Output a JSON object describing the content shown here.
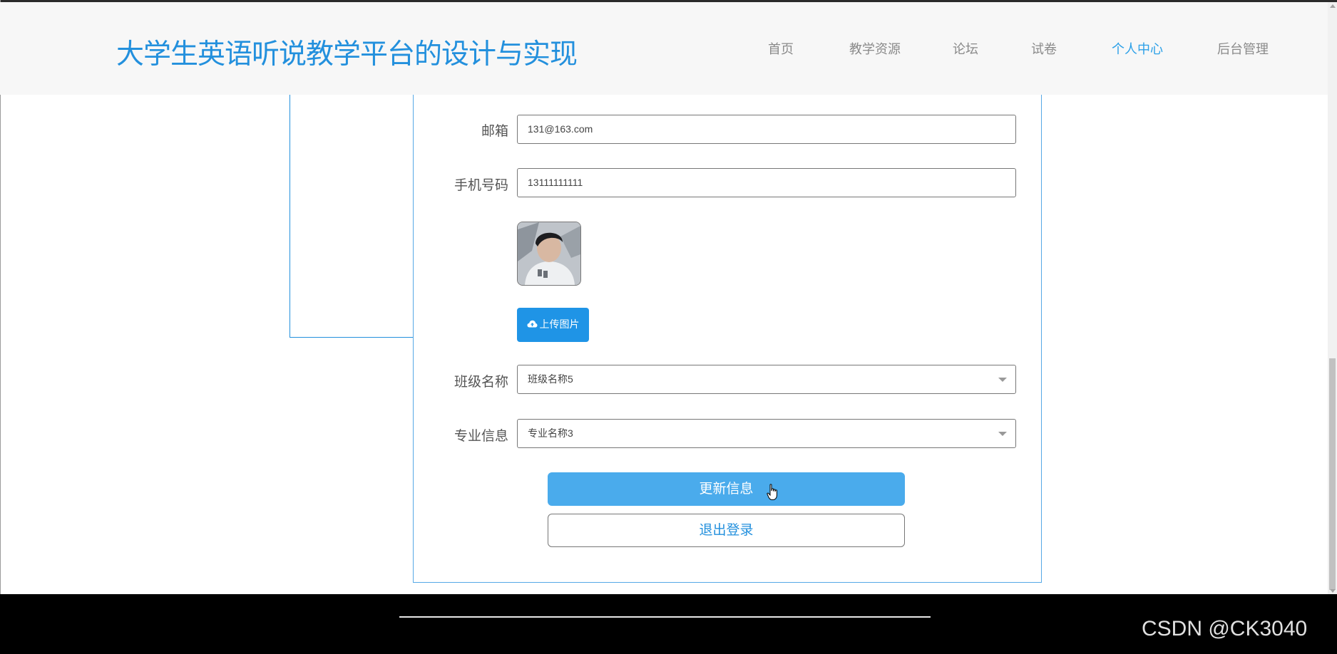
{
  "header": {
    "site_title": "大学生英语听说教学平台的设计与实现",
    "nav": [
      {
        "label": "首页",
        "active": false
      },
      {
        "label": "教学资源",
        "active": false
      },
      {
        "label": "论坛",
        "active": false
      },
      {
        "label": "试卷",
        "active": false
      },
      {
        "label": "个人中心",
        "active": true
      },
      {
        "label": "后台管理",
        "active": false
      }
    ]
  },
  "form": {
    "email": {
      "label": "邮箱",
      "value": "131@163.com"
    },
    "phone": {
      "label": "手机号码",
      "value": "13111111111"
    },
    "upload_button": "上传图片",
    "class_name": {
      "label": "班级名称",
      "value": "班级名称5"
    },
    "major": {
      "label": "专业信息",
      "value": "专业名称3"
    },
    "update_button": "更新信息",
    "logout_button": "退出登录"
  },
  "watermark": "CSDN @CK3040",
  "colors": {
    "brand": "#2390dd",
    "nav_active": "#2ba0e8",
    "primary_button": "#4aabec",
    "upload_button": "#1f94e6"
  }
}
